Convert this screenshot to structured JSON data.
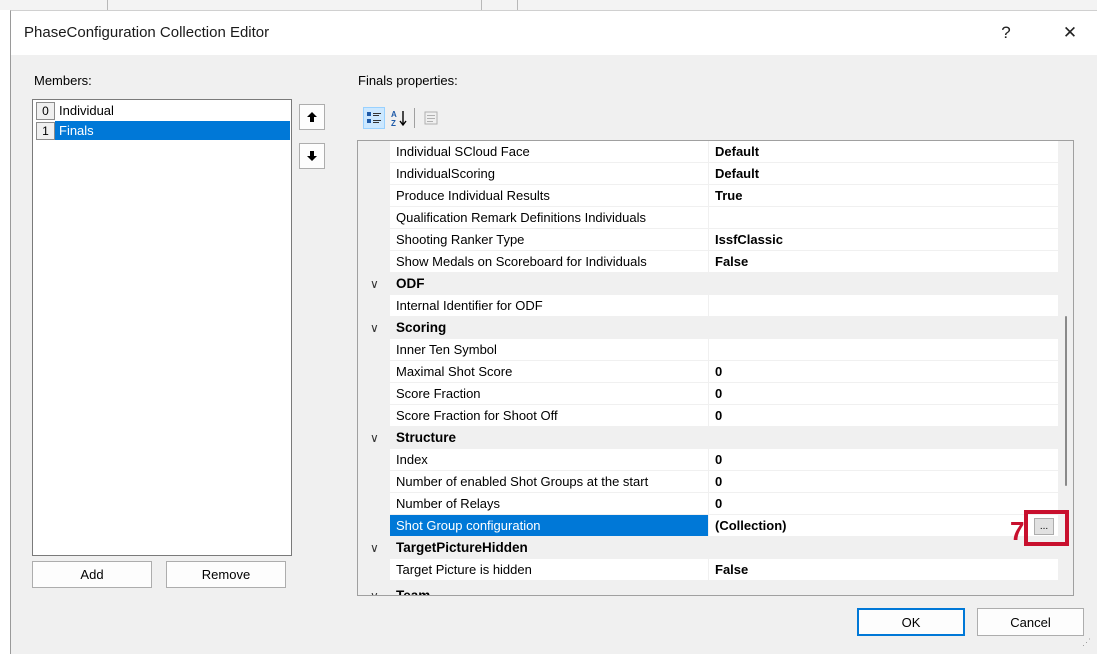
{
  "window": {
    "title": "PhaseConfiguration Collection Editor",
    "help_label": "?",
    "close_label": "✕"
  },
  "members": {
    "label": "Members:",
    "items": [
      {
        "index": "0",
        "name": "Individual",
        "selected": false
      },
      {
        "index": "1",
        "name": "Finals",
        "selected": true
      }
    ],
    "move_up_label": "🠉",
    "move_down_label": "🠋",
    "add_label": "Add",
    "remove_label": "Remove"
  },
  "properties": {
    "label": "Finals properties:",
    "rows": [
      {
        "type": "prop",
        "name": "Individual SCloud Face",
        "value": "Default"
      },
      {
        "type": "prop",
        "name": "IndividualScoring",
        "value": "Default"
      },
      {
        "type": "prop",
        "name": "Produce Individual Results",
        "value": "True"
      },
      {
        "type": "prop",
        "name": "Qualification Remark Definitions Individuals",
        "value": ""
      },
      {
        "type": "prop",
        "name": "Shooting Ranker Type",
        "value": "IssfClassic"
      },
      {
        "type": "prop",
        "name": "Show Medals on Scoreboard for Individuals",
        "value": "False"
      },
      {
        "type": "cat",
        "name": "ODF"
      },
      {
        "type": "prop",
        "name": "Internal Identifier for ODF",
        "value": ""
      },
      {
        "type": "cat",
        "name": "Scoring"
      },
      {
        "type": "prop",
        "name": "Inner Ten Symbol",
        "value": ""
      },
      {
        "type": "prop",
        "name": "Maximal Shot Score",
        "value": "0"
      },
      {
        "type": "prop",
        "name": "Score Fraction",
        "value": "0"
      },
      {
        "type": "prop",
        "name": "Score Fraction for Shoot Off",
        "value": "0"
      },
      {
        "type": "cat",
        "name": "Structure"
      },
      {
        "type": "prop",
        "name": "Index",
        "value": "0"
      },
      {
        "type": "prop",
        "name": "Number of enabled Shot Groups at the start",
        "value": "0"
      },
      {
        "type": "prop",
        "name": "Number of Relays",
        "value": "0"
      },
      {
        "type": "prop",
        "name": "Shot Group configuration",
        "value": "(Collection)",
        "selected": true
      },
      {
        "type": "cat",
        "name": "TargetPictureHidden"
      },
      {
        "type": "prop",
        "name": "Target Picture is hidden",
        "value": "False"
      },
      {
        "type": "cat",
        "name": "Team"
      }
    ],
    "ellipsis_label": "..."
  },
  "buttons": {
    "ok_label": "OK",
    "cancel_label": "Cancel"
  },
  "annotation": {
    "number": "7",
    "color": "#c8102e"
  },
  "icons": {
    "categorized": "categorized-icon",
    "alphabetical": "sort-alpha-icon",
    "property_pages": "property-pages-icon"
  },
  "colors": {
    "selection": "#0078d7",
    "dialog_bg": "#f0f0f0"
  }
}
